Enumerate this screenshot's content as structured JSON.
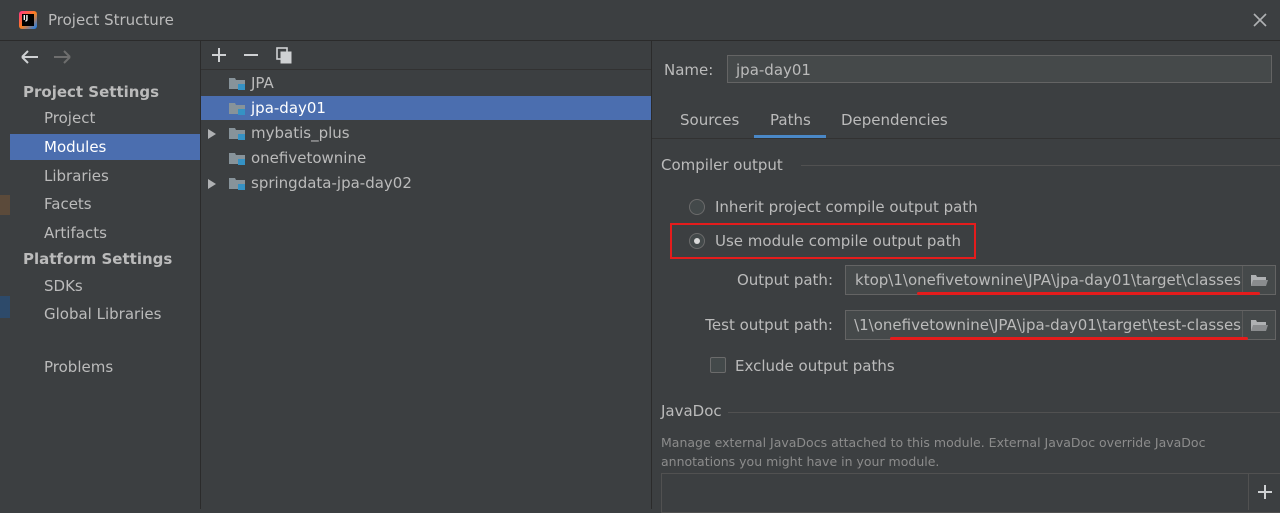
{
  "window": {
    "title": "Project Structure"
  },
  "sidebar": {
    "project_settings_header": "Project Settings",
    "project_items": [
      {
        "label": "Project"
      },
      {
        "label": "Modules"
      },
      {
        "label": "Libraries"
      },
      {
        "label": "Facets"
      },
      {
        "label": "Artifacts"
      }
    ],
    "platform_settings_header": "Platform Settings",
    "platform_items": [
      {
        "label": "SDKs"
      },
      {
        "label": "Global Libraries"
      }
    ],
    "problems_label": "Problems",
    "selected": "Modules"
  },
  "tree": {
    "toolbar": [
      "add-icon",
      "remove-icon",
      "copy-icon"
    ],
    "items": [
      {
        "label": "JPA",
        "expandable": false
      },
      {
        "label": "jpa-day01",
        "expandable": false,
        "selected": true
      },
      {
        "label": "mybatis_plus",
        "expandable": true
      },
      {
        "label": "onefivetownine",
        "expandable": false
      },
      {
        "label": "springdata-jpa-day02",
        "expandable": true
      }
    ]
  },
  "module": {
    "name_label": "Name:",
    "name_value": "jpa-day01",
    "tabs": [
      {
        "label": "Sources"
      },
      {
        "label": "Paths"
      },
      {
        "label": "Dependencies"
      }
    ],
    "active_tab": "Paths",
    "compiler_output": {
      "title": "Compiler output",
      "inherit_label": "Inherit project compile output path",
      "use_module_label": "Use module compile output path",
      "selected": "use_module",
      "output_path_label": "Output path:",
      "output_path_value": "ktop\\1\\onefivetownine\\JPA\\jpa-day01\\target\\classes",
      "test_output_path_label": "Test output path:",
      "test_output_path_value": "\\1\\onefivetownine\\JPA\\jpa-day01\\target\\test-classes",
      "exclude_label": "Exclude output paths",
      "exclude_checked": false
    },
    "javadoc": {
      "title": "JavaDoc",
      "description": "Manage external JavaDocs attached to this module. External JavaDoc override JavaDoc annotations you might have in your module."
    }
  },
  "colors": {
    "background": "#3c3f41",
    "selection": "#4b6eaf",
    "annotation_red": "#e51c1c",
    "tab_underline": "#4a88c7"
  }
}
